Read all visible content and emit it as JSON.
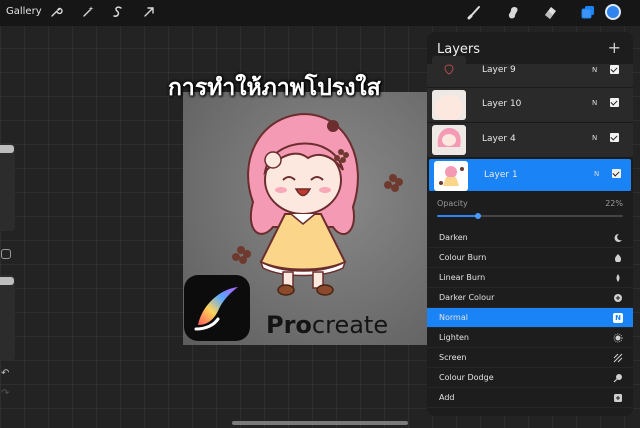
{
  "toolbar": {
    "gallery_label": "Gallery",
    "left_tools": [
      "wrench-icon",
      "magic-wand-icon",
      "selection-s-icon",
      "transform-arrow-icon"
    ],
    "right_tools": [
      "brush-icon",
      "smudge-icon",
      "eraser-icon",
      "layers-icon"
    ],
    "color_swatch": "#2f84f0"
  },
  "overlay": {
    "thai_title": "การทำให้ภาพโปรงใส",
    "wordmark_bold": "Pro",
    "wordmark_rest": "create"
  },
  "layers": {
    "title": "Layers",
    "add_symbol": "+",
    "items": [
      {
        "name": "Layer 9",
        "mode": "N",
        "visible": true,
        "active": false
      },
      {
        "name": "Layer 10",
        "mode": "N",
        "visible": true,
        "active": false
      },
      {
        "name": "Layer 4",
        "mode": "N",
        "visible": true,
        "active": false
      },
      {
        "name": "Layer 1",
        "mode": "N",
        "visible": true,
        "active": true
      }
    ],
    "opacity_label": "Opacity",
    "opacity_value": "22%",
    "opacity_fraction": 0.22,
    "blend_modes": [
      {
        "label": "Darken",
        "icon": "moon-icon"
      },
      {
        "label": "Colour Burn",
        "icon": "burn-icon"
      },
      {
        "label": "Linear Burn",
        "icon": "flame-icon"
      },
      {
        "label": "Darker Colour",
        "icon": "plus-circle-icon"
      },
      {
        "label": "Normal",
        "icon": "n-badge-icon",
        "badge": "N",
        "selected": true
      },
      {
        "label": "Lighten",
        "icon": "sun-icon"
      },
      {
        "label": "Screen",
        "icon": "stripes-icon"
      },
      {
        "label": "Colour Dodge",
        "icon": "dodge-icon"
      },
      {
        "label": "Add",
        "icon": "plus-square-icon"
      }
    ]
  },
  "colors": {
    "accent": "#1a83f5",
    "panel": "#1d1d1d",
    "background": "#232323"
  }
}
